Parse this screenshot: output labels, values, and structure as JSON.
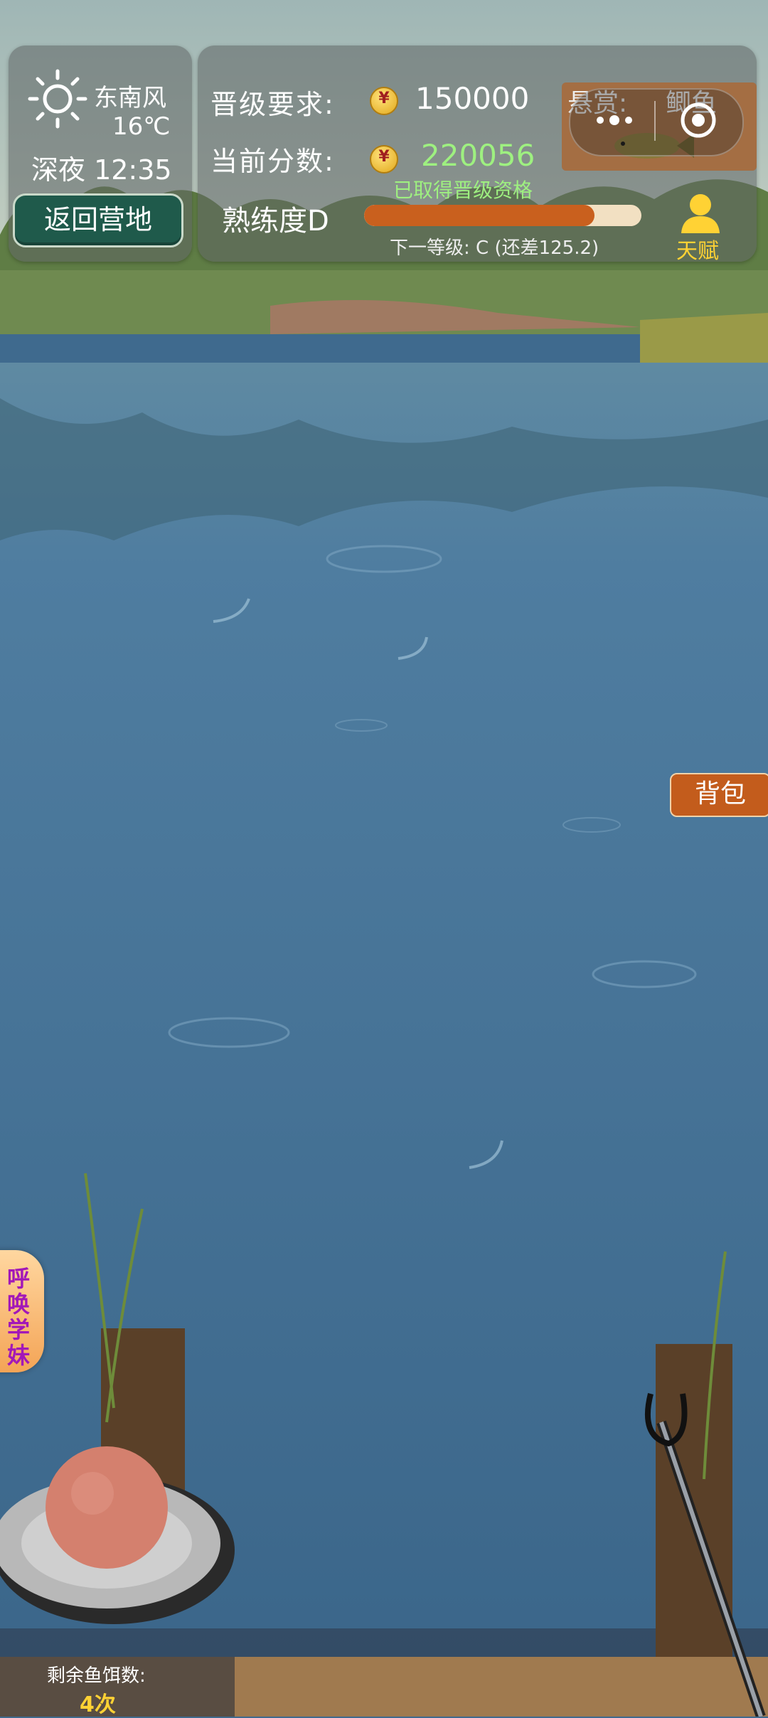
{
  "weather": {
    "icon": "sun-icon",
    "wind": "东南风",
    "temperature": "16℃",
    "time": "深夜 12:35"
  },
  "return_button": "返回营地",
  "score_panel": {
    "requirement_label": "晋级要求:",
    "requirement_value": "150000",
    "current_label": "当前分数:",
    "current_value": "220056",
    "qualified_text": "已取得晋级资格",
    "proficiency_label": "熟练度D",
    "proficiency_progress": 0.83,
    "next_level_text": "下一等级: C (还差125.2)",
    "talent_label": "天赋"
  },
  "bounty": {
    "label": "悬赏:",
    "fish": "鲫鱼"
  },
  "bag_button": "背包",
  "summon_button": "呼唤学妹",
  "bait": {
    "label": "剩余鱼饵数:",
    "count": "4次"
  },
  "colors": {
    "water": "#3f6a8e",
    "return_button_bg": "#1f5a4b",
    "progress_fill": "#c9601e",
    "accent_green": "#9ef080",
    "talent_yellow": "#ffd234",
    "bag_button_bg": "#c35c1c"
  }
}
